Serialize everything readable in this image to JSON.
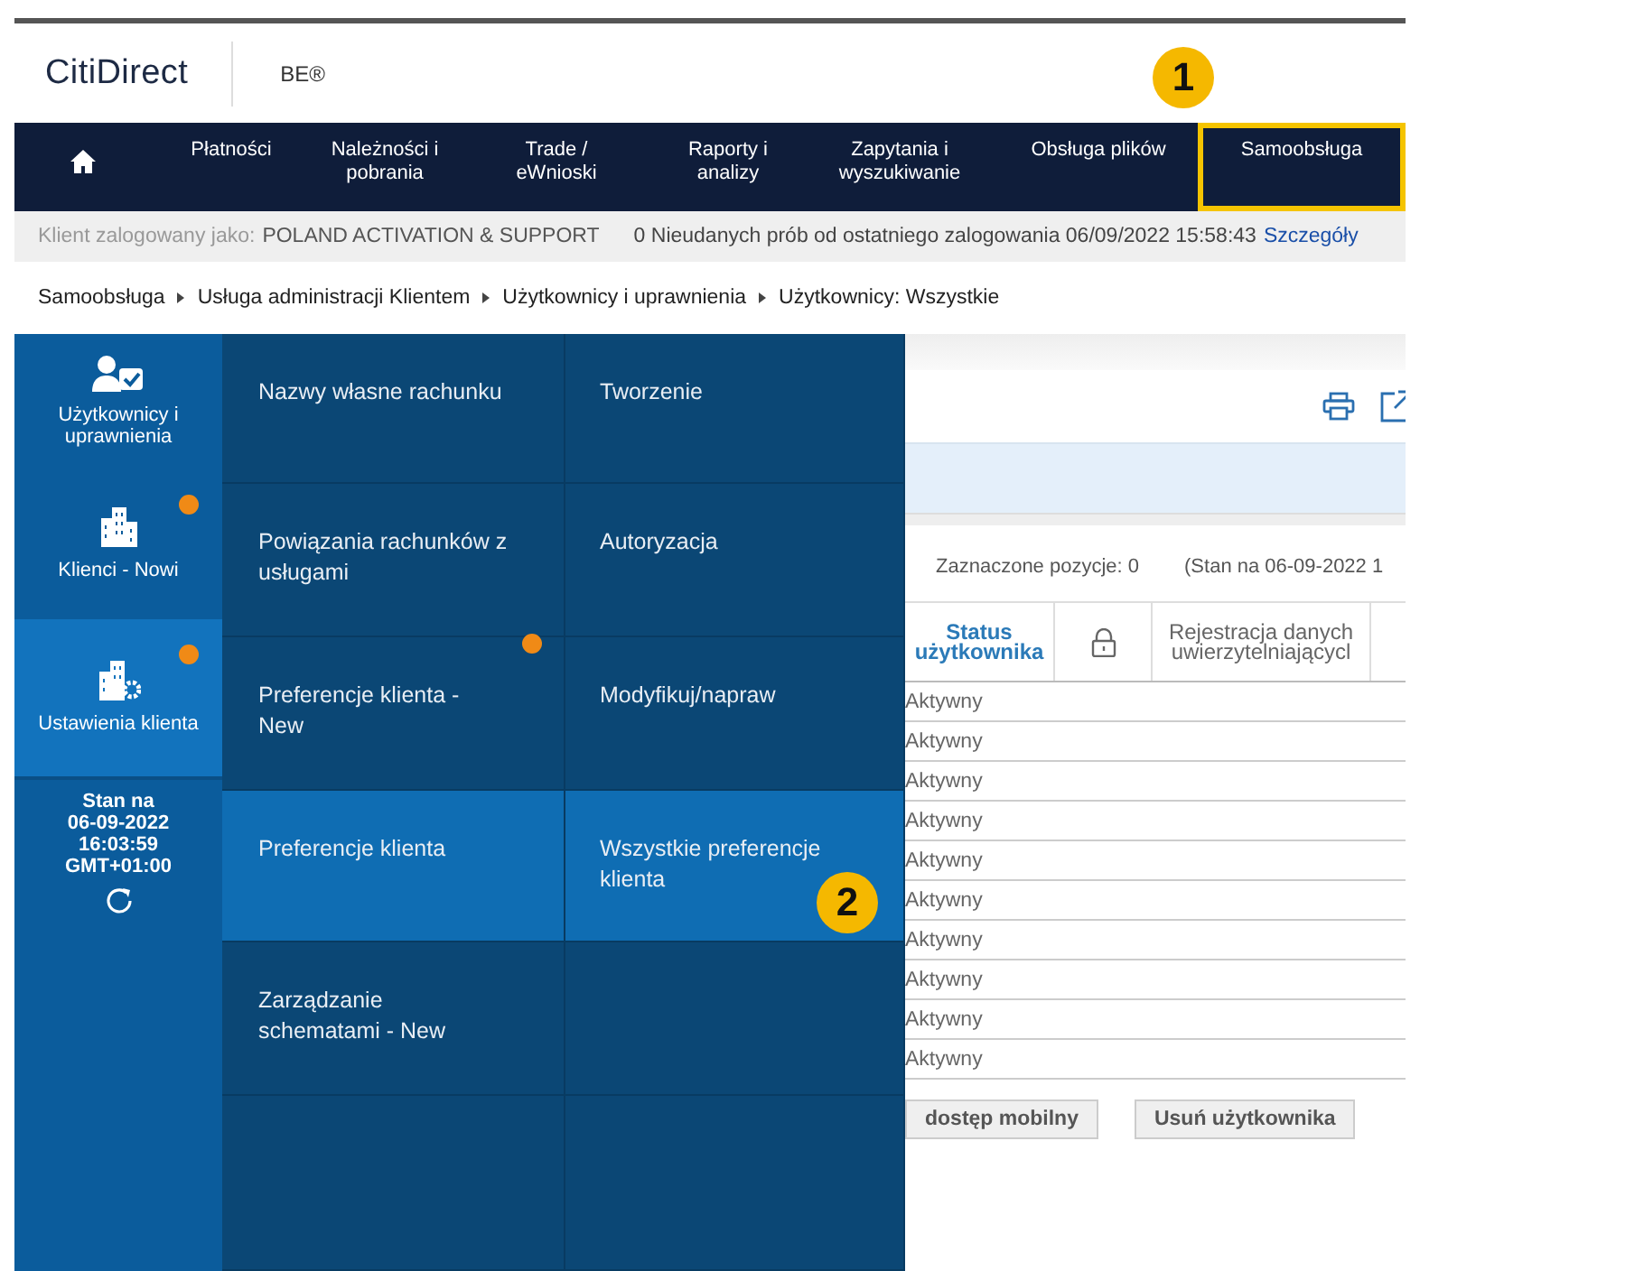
{
  "header": {
    "logo": "CitiDirect",
    "product": "BE®"
  },
  "callouts": [
    {
      "label": "1"
    },
    {
      "label": "2"
    }
  ],
  "nav": {
    "items": [
      {
        "kind": "home",
        "selected": false
      },
      {
        "kind": "text",
        "label": "Płatności",
        "selected": false
      },
      {
        "kind": "text",
        "label": "Należności i pobrania",
        "selected": false
      },
      {
        "kind": "text",
        "label": "Trade / eWnioski",
        "selected": false
      },
      {
        "kind": "text",
        "label": "Raporty i analizy",
        "selected": false
      },
      {
        "kind": "text",
        "label": "Zapytania i wyszukiwanie",
        "selected": false
      },
      {
        "kind": "text",
        "label": "Obsługa plików",
        "selected": false
      },
      {
        "kind": "text",
        "label": "Samoobsługa",
        "selected": true
      }
    ]
  },
  "info_bar": {
    "label": "Klient zalogowany jako:",
    "user": "POLAND ACTIVATION & SUPPORT",
    "notice": "0 Nieudanych prób od ostatniego zalogowania 06/09/2022 15:58:43",
    "link": "Szczegóły"
  },
  "breadcrumb": [
    "Samoobsługa",
    "Usługa administracji Klientem",
    "Użytkownicy i uprawnienia",
    "Użytkownicy: Wszystkie"
  ],
  "menu": {
    "categories": [
      {
        "label": "Użytkownicy i uprawnienia",
        "kind": "user",
        "selected": false,
        "dot": false
      },
      {
        "label": "Klienci - Nowi",
        "kind": "building",
        "selected": false,
        "dot": true
      },
      {
        "label": "Ustawienia klienta",
        "kind": "settings",
        "selected": true,
        "dot": true
      }
    ],
    "status": [
      "Stan na",
      "06-09-2022",
      "16:03:59",
      "GMT+01:00"
    ],
    "items": [
      {
        "label": "Nazwy własne rachunku",
        "selected": false,
        "dot": false
      },
      {
        "label": "Powiązania rachunków z usługami",
        "selected": false,
        "dot": false
      },
      {
        "label": "Preferencje klienta - New",
        "selected": false,
        "dot": true
      },
      {
        "label": "Preferencje klienta",
        "selected": true,
        "dot": false
      },
      {
        "label": "Zarządzanie schematami - New",
        "selected": false,
        "dot": false
      }
    ],
    "actions": [
      {
        "label": "Tworzenie",
        "selected": false
      },
      {
        "label": "Autoryzacja",
        "selected": false
      },
      {
        "label": "Modyfikuj/napraw",
        "selected": false
      },
      {
        "label": "Wszystkie preferencje klienta",
        "selected": true
      }
    ]
  },
  "content": {
    "selection": "Zaznaczone pozycje: 0",
    "as_of": "(Stan na 06-09-2022 1",
    "columns": [
      {
        "kind": "text",
        "label": "Status użytkownika"
      },
      {
        "kind": "lock"
      },
      {
        "kind": "text",
        "label": "Rejestracja danych uwierzytelniającycl"
      }
    ],
    "rows": [
      [
        "Aktywny"
      ],
      [
        "Aktywny"
      ],
      [
        "Aktywny"
      ],
      [
        "Aktywny"
      ],
      [
        "Aktywny"
      ],
      [
        "Aktywny"
      ],
      [
        "Aktywny"
      ],
      [
        "Aktywny"
      ],
      [
        "Aktywny"
      ],
      [
        "Aktywny"
      ]
    ],
    "buttons": [
      "dostęp mobilny",
      "Usuń użytkownika"
    ]
  }
}
